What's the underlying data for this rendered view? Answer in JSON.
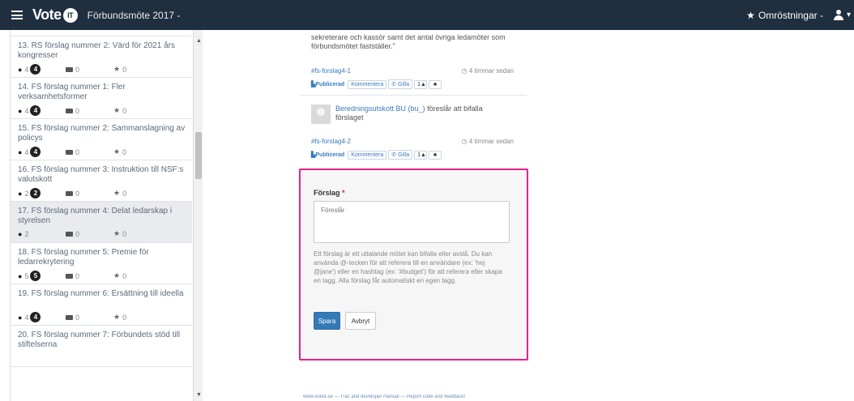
{
  "navbar": {
    "brand": "Vote",
    "brand_mark": "IT",
    "meeting": "Förbundsmöte 2017 -",
    "polls": "Omröstningar -",
    "user_caret": "▾"
  },
  "sidebar": {
    "items": [
      {
        "title": "",
        "stats": null
      },
      {
        "title": "13. RS förslag nummer 2: Värd för 2021 års kongresser",
        "proposals": "4",
        "badge": "4",
        "discussions": "0",
        "stars": "0"
      },
      {
        "title": "14. FS förslag nummer 1: Fler verksamhetsformer",
        "proposals": "4",
        "badge": "4",
        "discussions": "0",
        "stars": "0"
      },
      {
        "title": "15. FS förslag nummer 2: Sammanslagning av policys",
        "proposals": "4",
        "badge": "4",
        "discussions": "0",
        "stars": "0"
      },
      {
        "title": "16. FS förslag nummer 3: Instruktion till NSF:s valutskott",
        "proposals": "2",
        "badge": "2",
        "discussions": "0",
        "stars": "0"
      },
      {
        "title": "17. FS förslag nummer 4: Delat ledarskap i styrelsen",
        "proposals": "2",
        "badge": "",
        "discussions": "0",
        "stars": "0"
      },
      {
        "title": "18. FS förslag nummer 5: Premie för ledarrekrytering",
        "proposals": "5",
        "badge": "5",
        "discussions": "0",
        "stars": "0"
      },
      {
        "title": "19. FS förslag nummer 6: Ersättning till ideella",
        "proposals": "4",
        "badge": "4",
        "discussions": "0",
        "stars": "0"
      },
      {
        "title": "20. FS förslag nummer 7: Förbundets stöd till stiftelserna",
        "proposals": "",
        "badge": "",
        "discussions": "",
        "stars": ""
      }
    ]
  },
  "main": {
    "prop1_text": "sekreterare och kassör samt det antal övriga ledamöter som förbundsmötet fastställer.\"",
    "prop1_tag": "#fs-forslag4-1",
    "prop1_time": "4 timmar sedan",
    "prop2_author": "Beredningsutskott BU (bu_)",
    "prop2_text": "föreslår att bifalla förslaget",
    "prop2_tag": "#fs-forslag4-2",
    "prop2_time": "4 timmar sedan",
    "actions": {
      "published": "Publicerad",
      "comment": "Kommentera",
      "like": "Gilla",
      "count": "1",
      "share": "♣"
    }
  },
  "form": {
    "label": "Förslag",
    "required_mark": "*",
    "placeholder": "Föreslår",
    "help": "Ett förslag är ett uttalande mötet kan bifalla eller avslå. Du kan använda @-tecken för att referera till en användare (ex: 'hej @jane') eller en hashtag (ex: '#budget') för att referera eller skapa en tagg. Alla förslag får automatiskt en egen tagg.",
    "save": "Spara",
    "cancel": "Avbryt"
  },
  "footer": {
    "text": "www.voteit.se — Trac and developer manual — Report code and feedback!"
  }
}
